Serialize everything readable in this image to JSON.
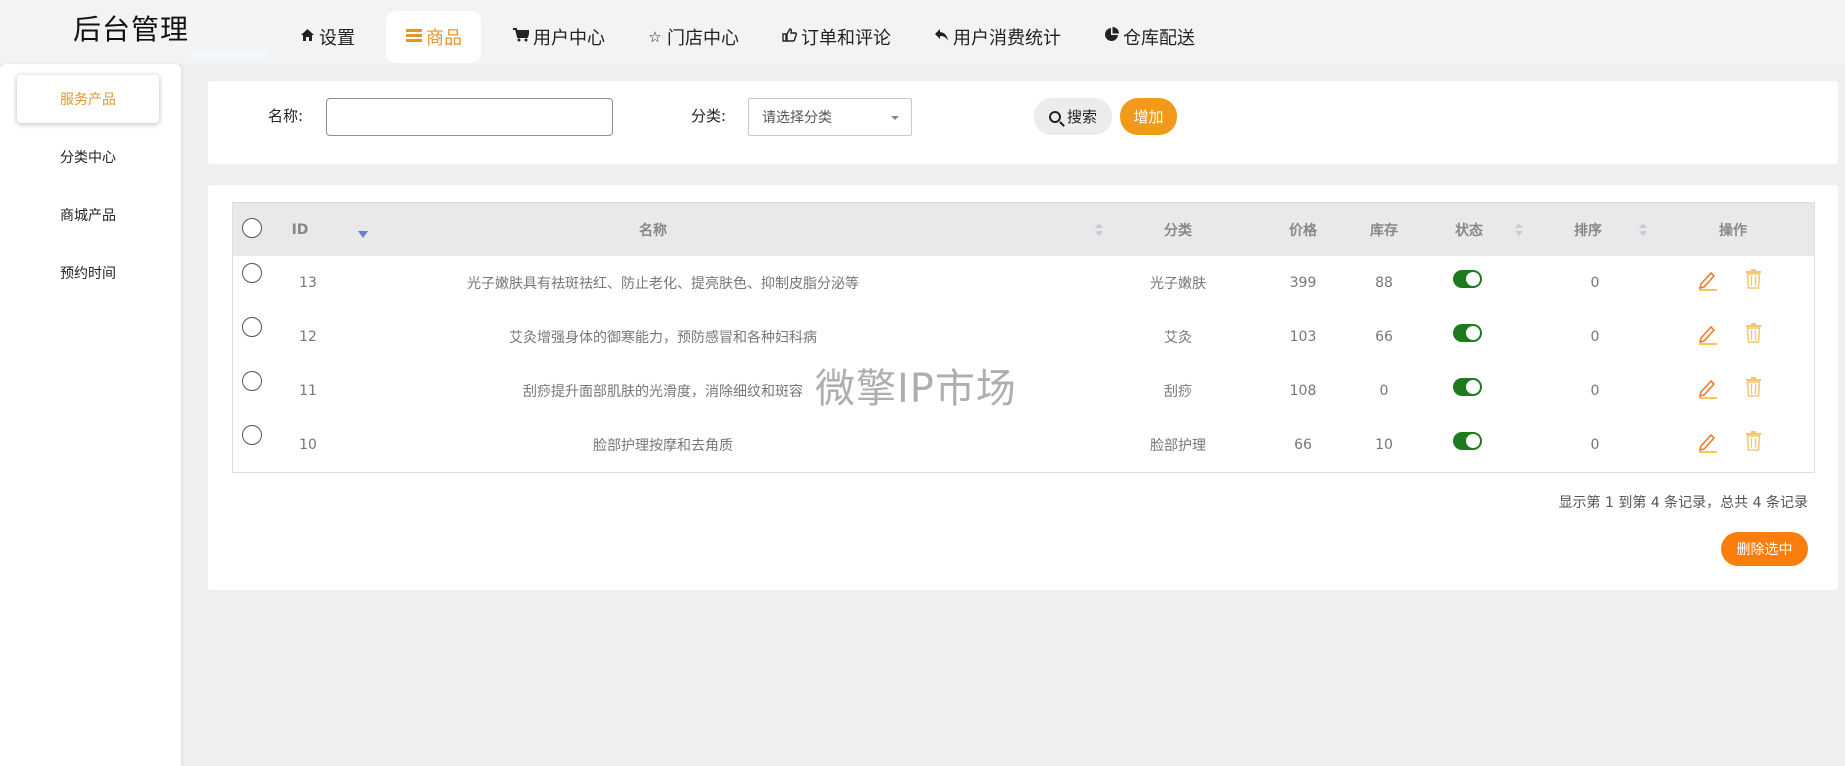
{
  "header": {
    "brand": "后台管理",
    "nav": [
      {
        "icon": "home-icon",
        "label": "设置",
        "active": false
      },
      {
        "icon": "table-icon",
        "label": "商品",
        "active": true
      },
      {
        "icon": "cart-icon",
        "label": "用户中心",
        "active": false
      },
      {
        "icon": "star-icon",
        "label": "门店中心",
        "active": false
      },
      {
        "icon": "thumbs-up-icon",
        "label": "订单和评论",
        "active": false
      },
      {
        "icon": "reply-icon",
        "label": "用户消费统计",
        "active": false
      },
      {
        "icon": "pie-chart-icon",
        "label": "仓库配送",
        "active": false
      }
    ]
  },
  "sidebar": {
    "items": [
      {
        "label": "服务产品",
        "active": true
      },
      {
        "label": "分类中心",
        "active": false
      },
      {
        "label": "商城产品",
        "active": false
      },
      {
        "label": "预约时间",
        "active": false
      }
    ]
  },
  "search": {
    "name_label": "名称:",
    "name_value": "",
    "category_label": "分类:",
    "category_placeholder": "请选择分类",
    "search_button": "搜索",
    "add_button": "增加"
  },
  "table": {
    "headers": {
      "id": "ID",
      "name": "名称",
      "category": "分类",
      "price": "价格",
      "stock": "库存",
      "status": "状态",
      "sort": "排序",
      "actions": "操作"
    },
    "rows": [
      {
        "id": "13",
        "name": "光子嫩肤具有祛斑祛红、防止老化、提亮肤色、抑制皮脂分泌等",
        "category": "光子嫩肤",
        "price": "399",
        "stock": "88",
        "status_on": true,
        "sort": "0"
      },
      {
        "id": "12",
        "name": "艾灸增强身体的御寒能力，预防感冒和各种妇科病",
        "category": "艾灸",
        "price": "103",
        "stock": "66",
        "status_on": true,
        "sort": "0"
      },
      {
        "id": "11",
        "name": "刮痧提升面部肌肤的光滑度，消除细纹和斑容",
        "category": "刮痧",
        "price": "108",
        "stock": "0",
        "status_on": true,
        "sort": "0"
      },
      {
        "id": "10",
        "name": "脸部护理按摩和去角质",
        "category": "脸部护理",
        "price": "66",
        "stock": "10",
        "status_on": true,
        "sort": "0"
      }
    ]
  },
  "pagination": {
    "info": "显示第 1 到第 4 条记录，总共 4 条记录"
  },
  "delete_selected": "删除选中",
  "watermark": "微擎IP市场",
  "colors": {
    "accent": "#e5952a",
    "add_button": "#f19a1a",
    "delete_button": "#fb7d0c",
    "toggle_on": "#1f7a1f",
    "sort_active": "#6b7bd6"
  }
}
